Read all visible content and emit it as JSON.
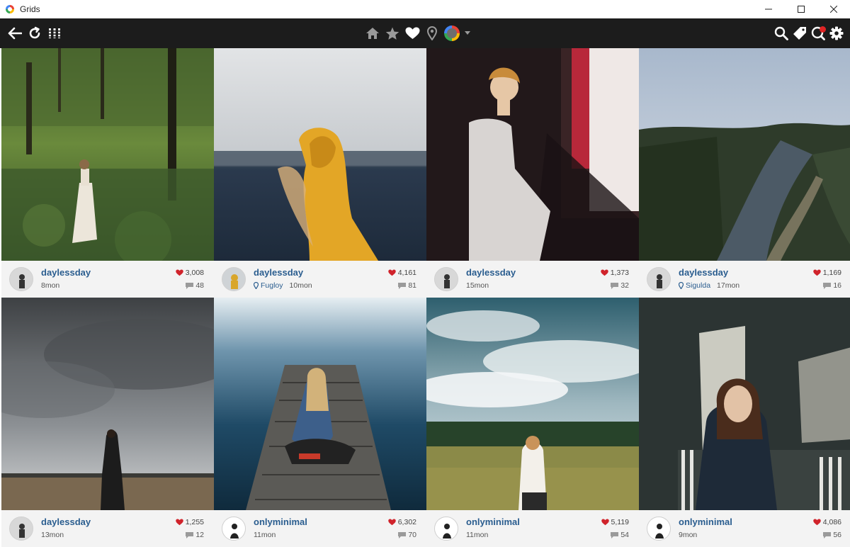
{
  "window": {
    "title": "Grids"
  },
  "toolbar": {
    "left_icons": [
      "back-icon",
      "refresh-icon",
      "grid-view-icon"
    ],
    "center_icons": [
      "home-icon",
      "star-icon",
      "heart-icon",
      "location-icon",
      "account-avatar-icon",
      "dropdown-icon"
    ],
    "right_icons": [
      "search-icon",
      "tag-icon",
      "notifications-icon",
      "settings-icon"
    ]
  },
  "posts": [
    {
      "username": "daylessday",
      "location": "",
      "time": "8mon",
      "likes": "3,008",
      "comments": "48"
    },
    {
      "username": "daylessday",
      "location": "Fugloy",
      "time": "10mon",
      "likes": "4,161",
      "comments": "81"
    },
    {
      "username": "daylessday",
      "location": "",
      "time": "15mon",
      "likes": "1,373",
      "comments": "32"
    },
    {
      "username": "daylessday",
      "location": "Sigulda",
      "time": "17mon",
      "likes": "1,169",
      "comments": "16"
    },
    {
      "username": "daylessday",
      "location": "",
      "time": "13mon",
      "likes": "1,255",
      "comments": "12"
    },
    {
      "username": "onlyminimal",
      "location": "",
      "time": "11mon",
      "likes": "6,302",
      "comments": "70"
    },
    {
      "username": "onlyminimal",
      "location": "",
      "time": "11mon",
      "likes": "5,119",
      "comments": "54"
    },
    {
      "username": "onlyminimal",
      "location": "",
      "time": "9mon",
      "likes": "4,086",
      "comments": "56"
    }
  ],
  "colors": {
    "toolbar_bg": "#1c1c1c",
    "username": "#2a5d8f",
    "heart": "#d0232b",
    "card_bg": "#f3f3f3"
  }
}
